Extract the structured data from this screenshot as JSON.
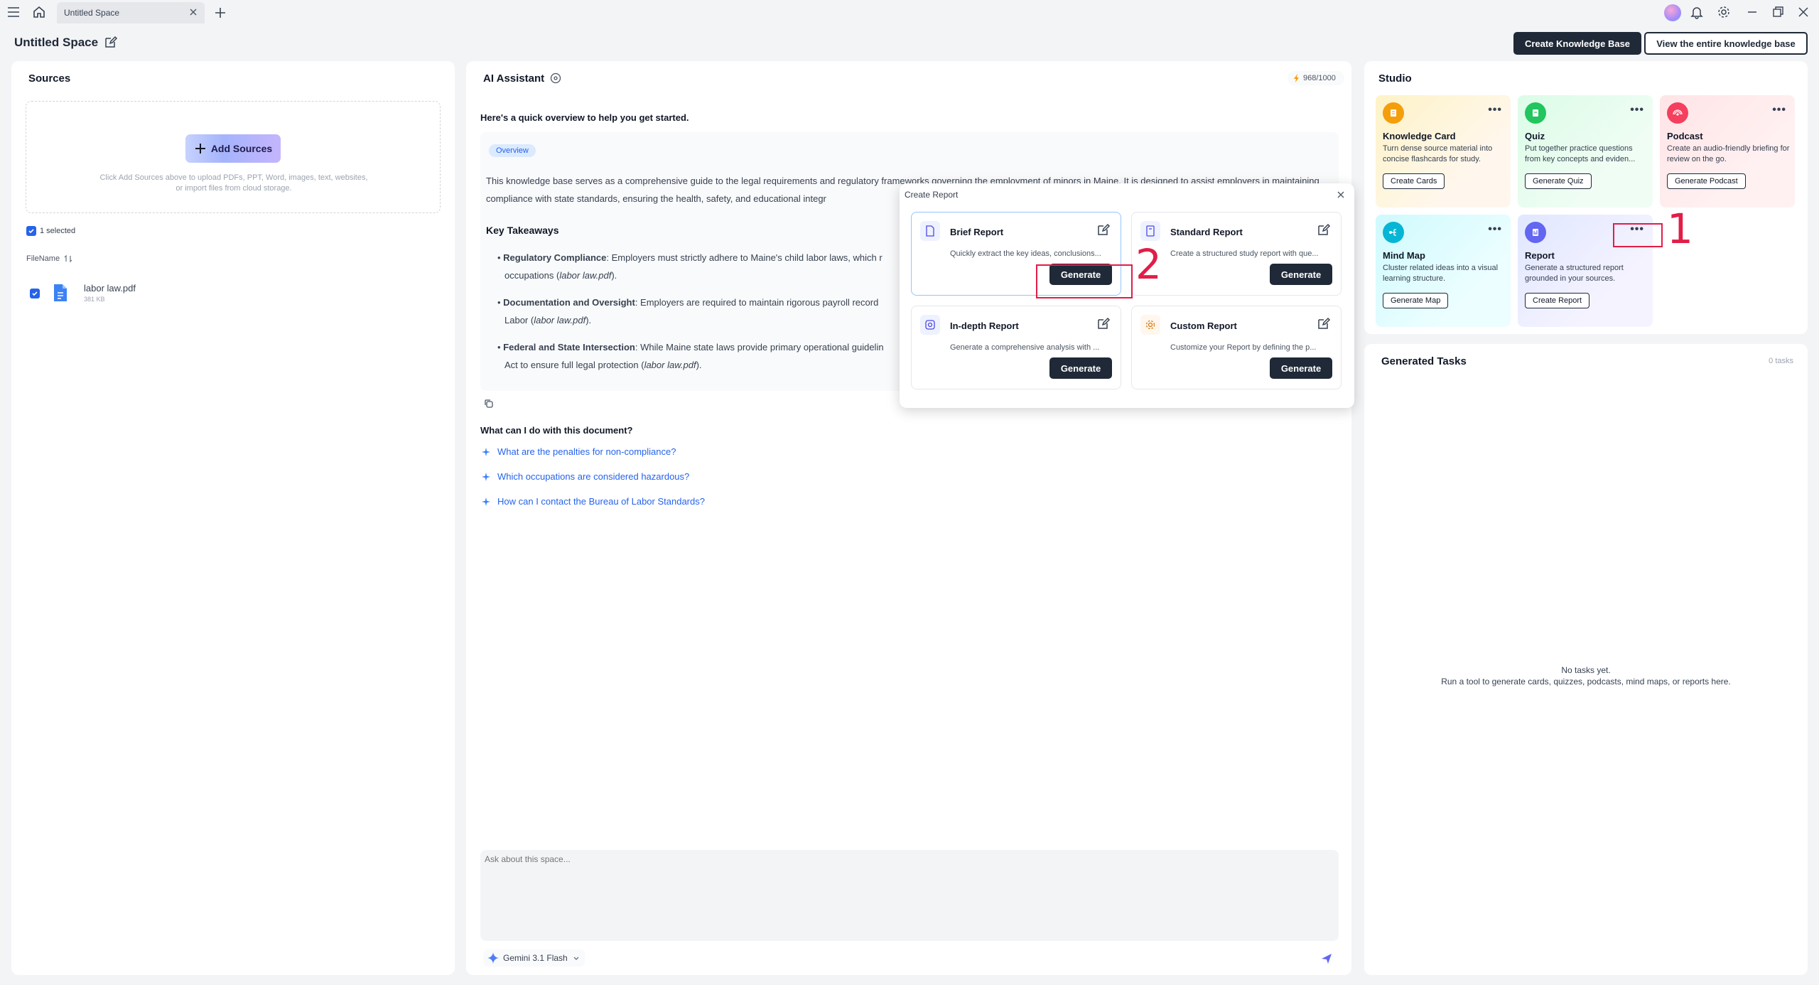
{
  "window": {
    "tab_title": "Untitled Space",
    "space_title": "Untitled Space"
  },
  "header": {
    "create_kb_label": "Create Knowledge Base",
    "view_kb_label": "View the entire knowledge base"
  },
  "sources": {
    "title": "Sources",
    "add_label": "Add Sources",
    "hint": "Click Add Sources above to upload PDFs, PPT, Word, images, text, websites, or import files from cloud storage.",
    "selected_label": "1 selected",
    "column_label": "FileName",
    "files": [
      {
        "name": "labor law.pdf",
        "size": "381 KB"
      }
    ]
  },
  "assistant": {
    "title": "AI Assistant",
    "credits": "968/1000",
    "intro": "Here's a quick overview to help you get started.",
    "overview_tag": "Overview",
    "overview_text": "This knowledge base serves as a comprehensive guide to the legal requirements and regulatory frameworks governing the employment of minors in Maine. It is designed to assist employers in maintaining compliance with state standards, ensuring the health, safety, and educational integr",
    "takeaways_title": "Key Takeaways",
    "takeaways": [
      {
        "bold": "Regulatory Compliance",
        "text": ": Employers must strictly adhere to Maine's child labor laws, which r",
        "line2": "occupations (",
        "src": "labor law.pdf",
        "end": ")."
      },
      {
        "bold": "Documentation and Oversight",
        "text": ": Employers are required to maintain rigorous payroll record",
        "line2": "Labor (",
        "src": "labor law.pdf",
        "end": ")."
      },
      {
        "bold": "Federal and State Intersection",
        "text": ": While Maine state laws provide primary operational guidelin",
        "line2": "Act to ensure full legal protection (",
        "src": "labor law.pdf",
        "end": ")."
      }
    ],
    "question_title": "What can I do with this document?",
    "suggestions": [
      "What are the penalties for non-compliance?",
      "Which occupations are considered hazardous?",
      "How can I contact the Bureau of Labor Standards?"
    ],
    "input_placeholder": "Ask about this space...",
    "model_label": "Gemini 3.1 Flash"
  },
  "popup": {
    "title": "Create Report",
    "generate_label": "Generate",
    "cards": [
      {
        "title": "Brief Report",
        "desc": "Quickly extract the key ideas, conclusions..."
      },
      {
        "title": "Standard Report",
        "desc": "Create a structured study report with que..."
      },
      {
        "title": "In-depth Report",
        "desc": "Generate a comprehensive analysis with ..."
      },
      {
        "title": "Custom Report",
        "desc": "Customize your Report by defining the p..."
      }
    ]
  },
  "studio": {
    "title": "Studio",
    "cards": [
      {
        "title": "Knowledge Card",
        "desc": "Turn dense source material into concise flashcards for study.",
        "button": "Create Cards",
        "icon": "note-icon",
        "color": "#f59e0b"
      },
      {
        "title": "Quiz",
        "desc": "Put together practice questions from key concepts and eviden...",
        "button": "Generate Quiz",
        "icon": "quiz-icon",
        "color": "#22c55e"
      },
      {
        "title": "Podcast",
        "desc": "Create an audio-friendly briefing for review on the go.",
        "button": "Generate Podcast",
        "icon": "podcast-icon",
        "color": "#f43f5e"
      },
      {
        "title": "Mind Map",
        "desc": "Cluster related ideas into a visual learning structure.",
        "button": "Generate Map",
        "icon": "mindmap-icon",
        "color": "#06b6d4"
      },
      {
        "title": "Report",
        "desc": "Generate a structured report grounded in your sources.",
        "button": "Create Report",
        "icon": "report-icon",
        "color": "#6366f1"
      }
    ]
  },
  "tasks": {
    "title": "Generated Tasks",
    "count": "0 tasks",
    "empty_title": "No tasks yet.",
    "empty_hint": "Run a tool to generate cards, quizzes, podcasts, mind maps, or reports here."
  },
  "annotations": {
    "label_1": "1",
    "label_2": "2"
  }
}
